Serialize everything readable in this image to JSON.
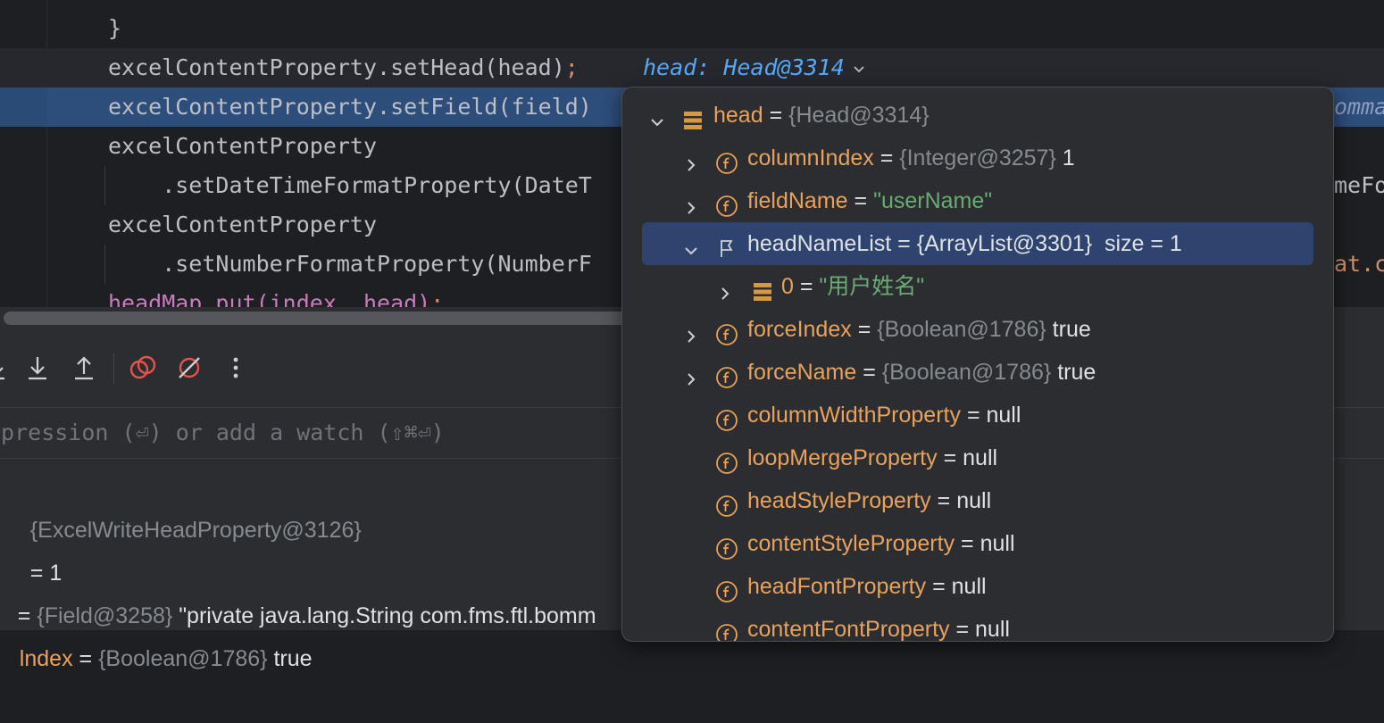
{
  "editor": {
    "lines": [
      {
        "text": "}",
        "kind": "normal"
      },
      {
        "text": "excelContentProperty.setHead(head)",
        "semi": ";",
        "kind": "current"
      },
      {
        "text": "excelContentProperty.setField(field)",
        "kind": "exec"
      },
      {
        "text": "excelContentProperty",
        "kind": "normal"
      },
      {
        "text": "    .setDateTimeFormatProperty(DateT",
        "kind": "normal"
      },
      {
        "text": "excelContentProperty",
        "kind": "normal"
      },
      {
        "text": "    .setNumberFormatProperty(NumberF",
        "kind": "normal"
      },
      {
        "text": "headMap.put(index, head)",
        "semi": ";",
        "kind": "normal"
      }
    ],
    "inlay_hint": "head: Head@3314",
    "right_fragments": [
      "omma",
      "meFo",
      "at.c"
    ]
  },
  "toolbar": {
    "icons": [
      "step-into-icon",
      "step-out-icon",
      "view-breakpoints-icon",
      "mute-breakpoints-icon",
      "more-options-icon"
    ]
  },
  "evaluate": {
    "placeholder": "xpression (⏎) or add a watch (⇧⌘⏎)"
  },
  "variables": [
    {
      "name": "",
      "type": "{ExcelWriteHeadProperty@3126}",
      "value": ""
    },
    {
      "name": "",
      "type": "",
      "value": "= 1"
    },
    {
      "name": "",
      "type": "{Field@3258}",
      "value": "\"private java.lang.String com.fms.ftl.bomm"
    },
    {
      "name": "lndex",
      "type": "{Boolean@1786}",
      "value": "true"
    }
  ],
  "popup": {
    "rows": [
      {
        "name": "head",
        "eq": "=",
        "type": "{Head@3314}",
        "value": "",
        "icon": "object-icon",
        "expand": "expanded",
        "indent": 0
      },
      {
        "name": "columnIndex",
        "eq": "=",
        "type": "{Integer@3257}",
        "value": "1",
        "icon": "field-icon",
        "expand": "collapsed",
        "indent": 1
      },
      {
        "name": "fieldName",
        "eq": "=",
        "type": "",
        "value": "\"userName\"",
        "string": true,
        "icon": "field-icon",
        "expand": "collapsed",
        "indent": 1
      },
      {
        "name": "headNameList",
        "eq": "=",
        "type": "",
        "value": "{ArrayList@3301}  size = 1",
        "icon": "flag-icon",
        "expand": "expanded",
        "indent": 1,
        "selected": true
      },
      {
        "name": "0",
        "eq": "=",
        "type": "",
        "value": "\"用户姓名\"",
        "string": true,
        "icon": "object-icon",
        "expand": "collapsed",
        "indent": 2
      },
      {
        "name": "forceIndex",
        "eq": "=",
        "type": "{Boolean@1786}",
        "value": "true",
        "icon": "field-icon",
        "expand": "collapsed",
        "indent": 1
      },
      {
        "name": "forceName",
        "eq": "=",
        "type": "{Boolean@1786}",
        "value": "true",
        "icon": "field-icon",
        "expand": "collapsed",
        "indent": 1
      },
      {
        "name": "columnWidthProperty",
        "eq": "=",
        "type": "",
        "value": "null",
        "icon": "field-icon",
        "expand": "none",
        "indent": 1
      },
      {
        "name": "loopMergeProperty",
        "eq": "=",
        "type": "",
        "value": "null",
        "icon": "field-icon",
        "expand": "none",
        "indent": 1
      },
      {
        "name": "headStyleProperty",
        "eq": "=",
        "type": "",
        "value": "null",
        "icon": "field-icon",
        "expand": "none",
        "indent": 1
      },
      {
        "name": "contentStyleProperty",
        "eq": "=",
        "type": "",
        "value": "null",
        "icon": "field-icon",
        "expand": "none",
        "indent": 1
      },
      {
        "name": "headFontProperty",
        "eq": "=",
        "type": "",
        "value": "null",
        "icon": "field-icon",
        "expand": "none",
        "indent": 1
      },
      {
        "name": "contentFontProperty",
        "eq": "=",
        "type": "",
        "value": "null",
        "icon": "field-icon",
        "expand": "none",
        "indent": 1
      }
    ]
  },
  "colors": {
    "field_icon": "#e8a25c",
    "string": "#6aab73",
    "type_gray": "#868a91",
    "selection": "#2e436e",
    "exec_line": "#2d4d7a",
    "inlay": "#56a8f5"
  }
}
